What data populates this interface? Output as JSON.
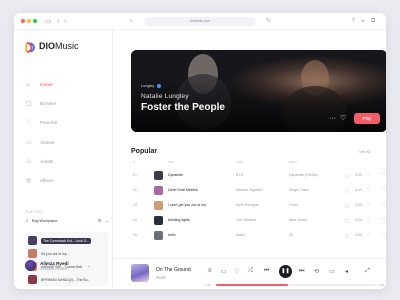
{
  "browser": {
    "url": "dribbble.com"
  },
  "app": {
    "logo_bold": "DIO",
    "logo_light": "Music",
    "accent": "#f0505f"
  },
  "nav": [
    {
      "label": "Home",
      "icon": "home-icon",
      "active": true
    },
    {
      "label": "Browse",
      "icon": "browse-icon",
      "active": false
    },
    {
      "label": "Favorite",
      "icon": "heart-icon",
      "active": false
    },
    {
      "label": "Videos",
      "icon": "video-icon",
      "active": false
    },
    {
      "label": "Artists",
      "icon": "artist-icon",
      "active": false
    },
    {
      "label": "Album",
      "icon": "album-icon",
      "active": false
    }
  ],
  "playlist": {
    "section_label": "PLAYLIST",
    "name": "Ray Workplace",
    "items": [
      {
        "title": "The Comeback Kid – Lindi O..."
      },
      {
        "title": "It's you out of my..."
      },
      {
        "title": "ArtBoNE Skc – Cosmo Belt"
      },
      {
        "title": "BFRIMGN ScHAD(2) – The Bu..."
      }
    ]
  },
  "user": {
    "name": "Alimza Ryedi",
    "subtitle": "Soundtrax Member"
  },
  "hero": {
    "tag": "Lungley",
    "artist": "Natalie Lungley",
    "title": "Foster the People",
    "play_label": "Play"
  },
  "popular": {
    "title": "Popular",
    "see_all": "See All",
    "columns": [
      "#",
      "Title",
      "Artist",
      "Album"
    ],
    "rows": [
      {
        "num": "01",
        "title": "Dynamite",
        "artist": "BTS",
        "album": "Dynamite (Remix)",
        "time": "3:39",
        "art": "#3d3a48"
      },
      {
        "num": "02",
        "title": "Detel Grail Mebbin",
        "artist": "Mohuto Yagdizin",
        "album": "Single Track",
        "time": "4:12",
        "art": "#a46ba2"
      },
      {
        "num": "03",
        "title": "I can't get you out of my",
        "artist": "Kylie Minogue",
        "album": "Fever",
        "time": "3:50",
        "art": "#cf9c79"
      },
      {
        "num": "04",
        "title": "blinding lights",
        "artist": "The Weeknd",
        "album": "After Hours",
        "time": "3:20",
        "art": "#2a2e38"
      },
      {
        "num": "05",
        "title": "hello",
        "artist": "Adele",
        "album": "25",
        "time": "4:55",
        "art": "#6b6e74"
      }
    ]
  },
  "player": {
    "title": "On The Ground",
    "artist": "Rosé",
    "elapsed": "1:15",
    "total": "2:48",
    "progress": 0.45
  }
}
